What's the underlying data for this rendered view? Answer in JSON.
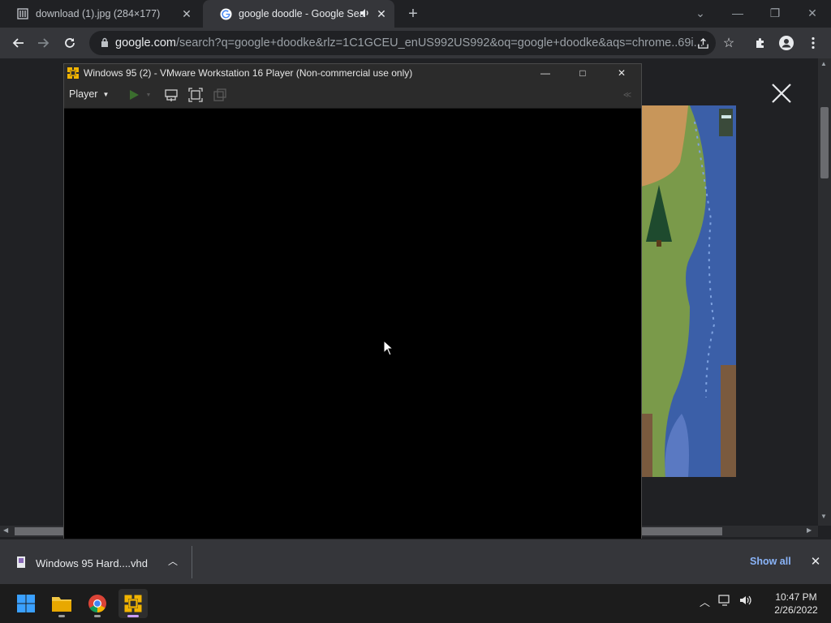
{
  "browser": {
    "tabs": [
      {
        "label": "download (1).jpg (284×177)",
        "icon": "image-doc-icon"
      },
      {
        "label": "google doodle - Google Sea",
        "icon": "google-g-icon",
        "audio_icon": "speaker-icon"
      }
    ],
    "address": {
      "host": "google.com",
      "rest": "/search?q=google+doodke&rlz=1C1GCEU_enUS992US992&oq=google+doodke&aqs=chrome..69i..."
    }
  },
  "vmware": {
    "title": "Windows 95 (2) - VMware Workstation 16 Player (Non-commercial use only)",
    "menu_label": "Player"
  },
  "download_shelf": {
    "file_name": "Windows 95 Hard....vhd",
    "show_all": "Show all"
  },
  "taskbar": {
    "time": "10:47 PM",
    "date": "2/26/2022"
  },
  "colors": {
    "accent": "#8ab4f8",
    "chrome_dark": "#202124",
    "chrome_toolbar": "#35363a",
    "vm_chrome": "#2b2b2b"
  }
}
